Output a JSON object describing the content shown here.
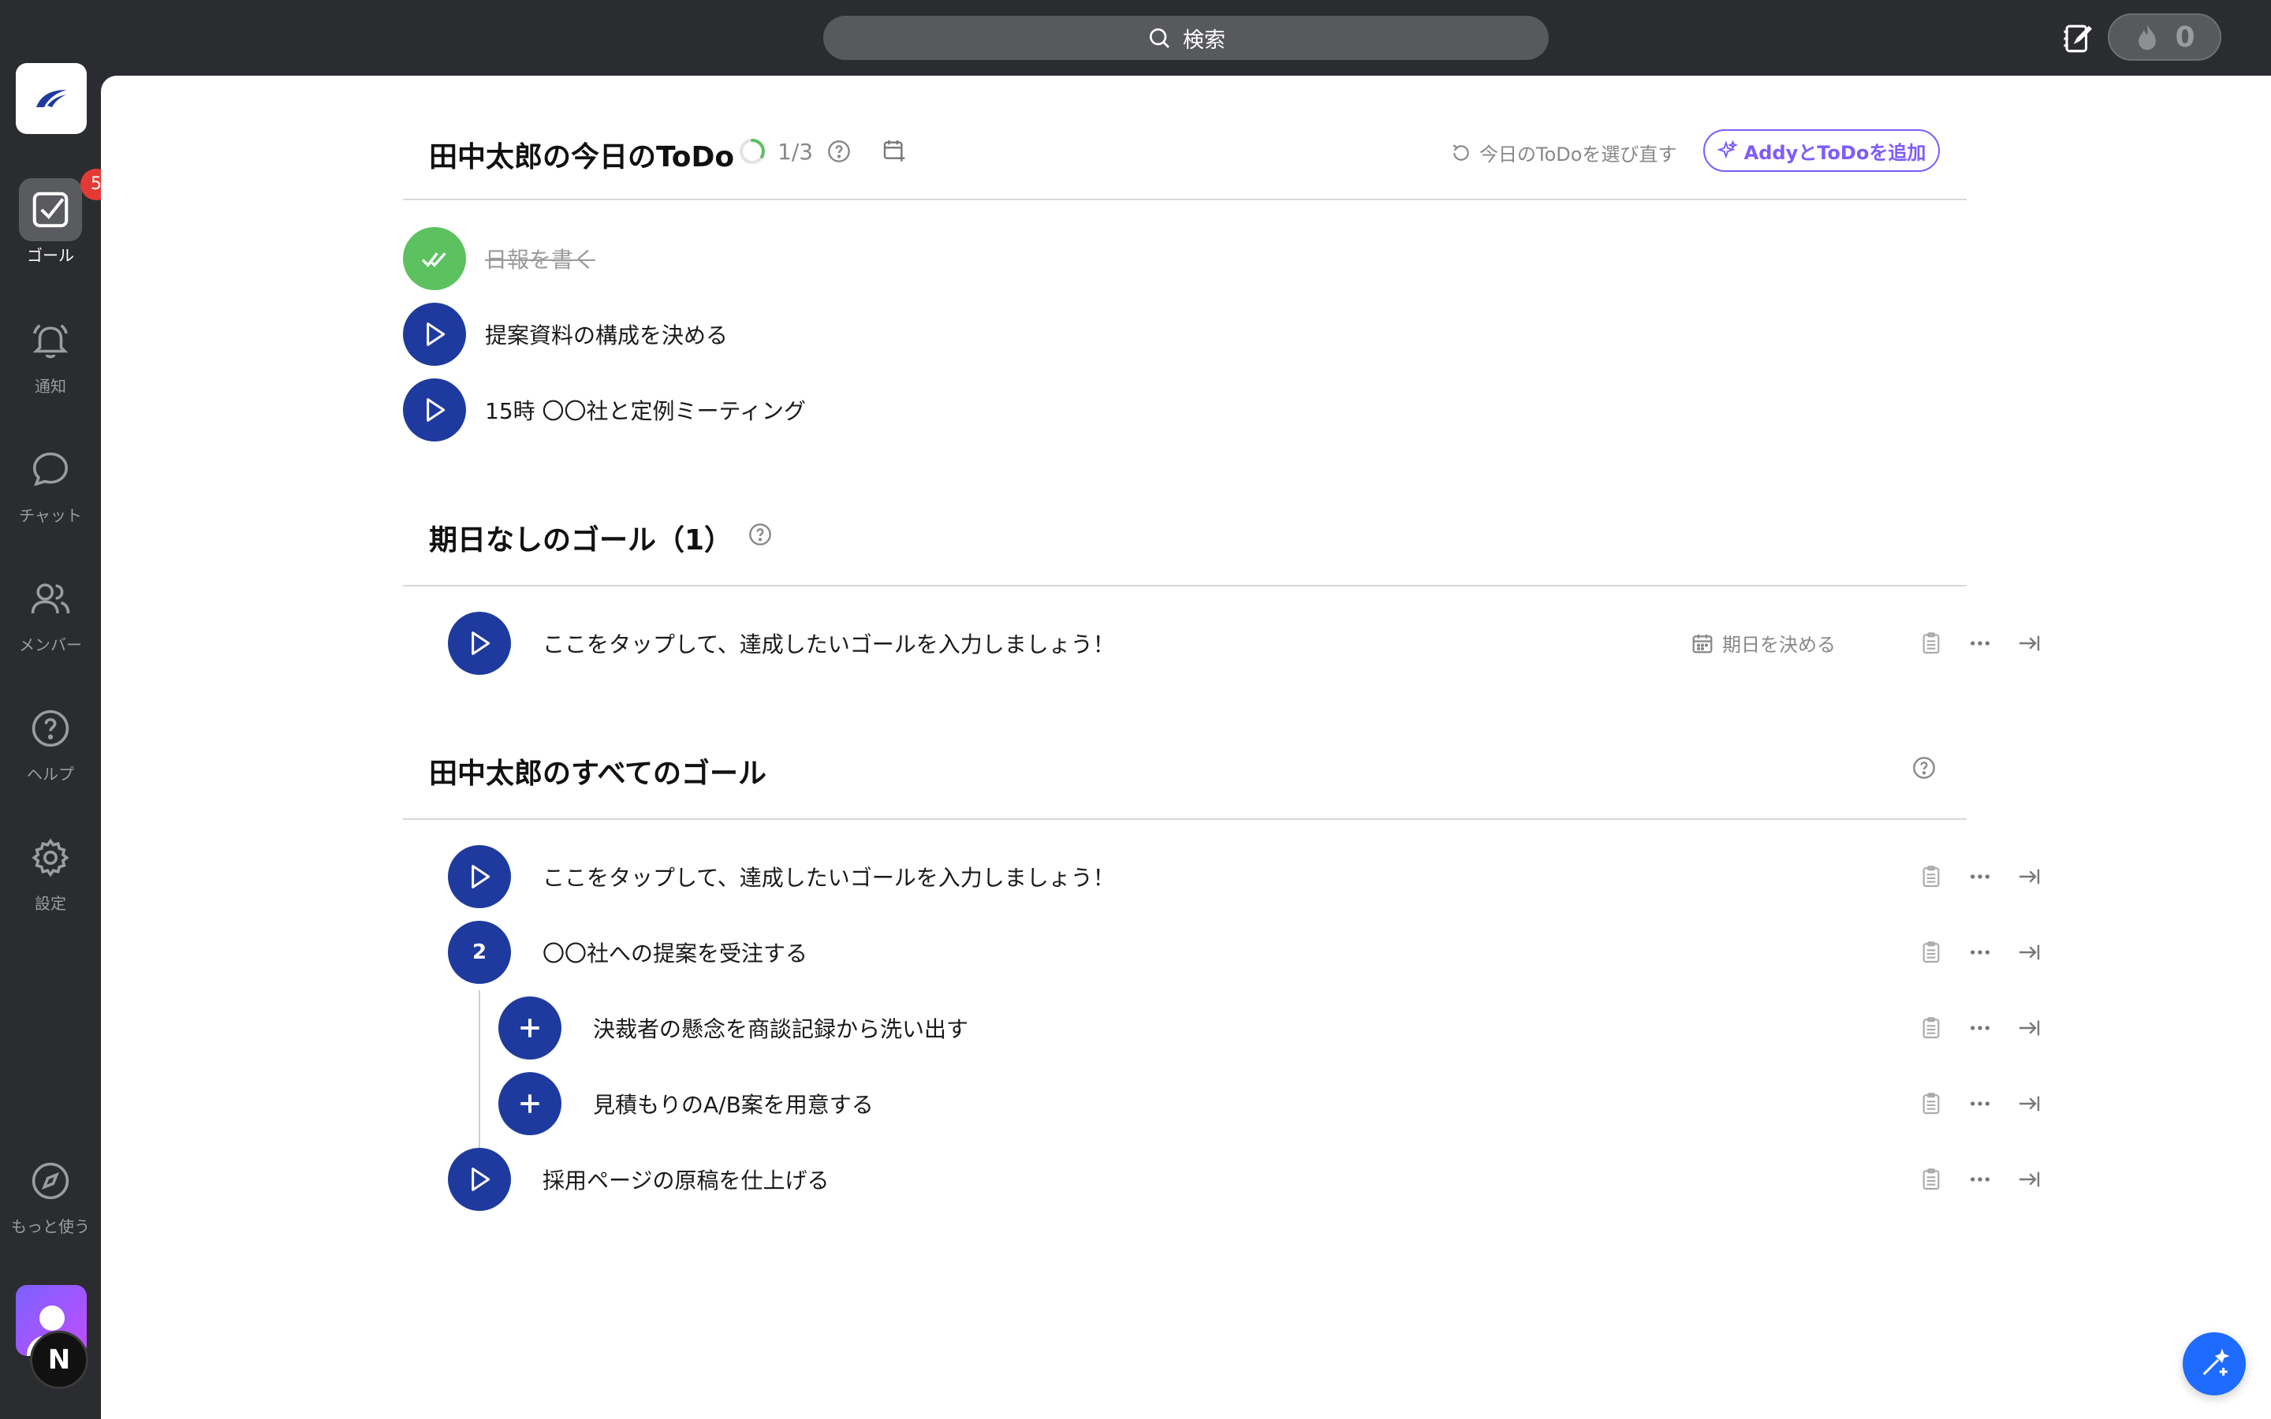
{
  "search": {
    "label": "検索"
  },
  "streak": {
    "count": "0"
  },
  "sidebar": {
    "items": [
      {
        "label": "ゴール",
        "icon": "checkbox-icon",
        "badge": "5",
        "active": true
      },
      {
        "label": "通知",
        "icon": "bell-icon"
      },
      {
        "label": "チャット",
        "icon": "chat-icon"
      },
      {
        "label": "メンバー",
        "icon": "members-icon"
      },
      {
        "label": "ヘルプ",
        "icon": "help-icon"
      },
      {
        "label": "設定",
        "icon": "gear-icon"
      },
      {
        "label": "もっと使う",
        "icon": "compass-icon"
      }
    ],
    "profile_badge": "N"
  },
  "todo": {
    "title": "田中太郎の今日のToDo",
    "progress": "1/3",
    "progress_fraction": 0.333,
    "reselect_label": "今日のToDoを選び直す",
    "addy_label": "AddyとToDoを追加",
    "items": [
      {
        "text": "日報を書く",
        "done": true
      },
      {
        "text": "提案資料の構成を決める",
        "done": false
      },
      {
        "text": "15時 〇〇社と定例ミーティング",
        "done": false
      }
    ]
  },
  "no_due": {
    "title": "期日なしのゴール（1）",
    "items": [
      {
        "text": "ここをタップして、達成したいゴールを入力しましょう！",
        "due_label": "期日を決める"
      }
    ]
  },
  "all_goals": {
    "title": "田中太郎のすべてのゴール",
    "items": [
      {
        "text": "ここをタップして、達成したいゴールを入力しましょう！"
      },
      {
        "text": "〇〇社への提案を受注する",
        "count": "2"
      },
      {
        "text": "決裁者の懸念を商談記録から洗い出す",
        "child": true
      },
      {
        "text": "見積もりのA/B案を用意する",
        "child": true
      },
      {
        "text": "採用ページの原稿を仕上げる"
      }
    ]
  },
  "colors": {
    "accent": "#1f3a9e",
    "done": "#5cc15f",
    "addy": "#7c5cff",
    "fab": "#1e6bff",
    "badge": "#e53935"
  }
}
